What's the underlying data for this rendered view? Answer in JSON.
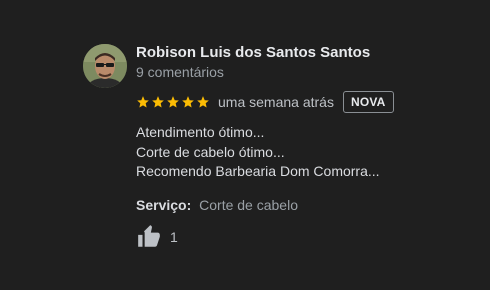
{
  "review": {
    "author_name": "Robison Luis dos Santos Santos",
    "author_meta": "9 comentários",
    "rating": 5,
    "time_ago": "uma semana atrás",
    "badge": "NOVA",
    "text_lines": [
      "Atendimento ótimo...",
      "Corte de cabelo ótimo...",
      "Recomendo Barbearia Dom Comorra..."
    ],
    "service_label": "Serviço:",
    "service_value": "Corte de cabelo",
    "like_count": "1",
    "icons": {
      "star": "star-icon",
      "like": "thumbs-up-icon"
    },
    "colors": {
      "star": "#fbbc04",
      "background": "#1f1f1f"
    }
  }
}
